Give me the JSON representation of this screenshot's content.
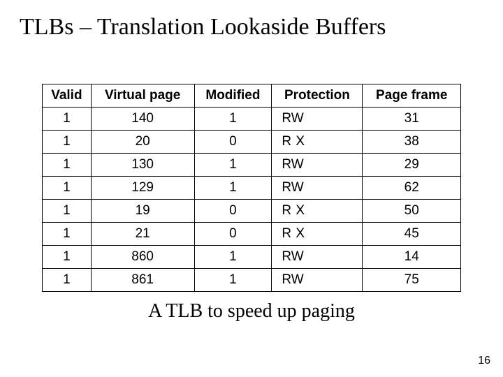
{
  "title": "TLBs – Translation Lookaside Buffers",
  "caption": "A TLB to speed up paging",
  "page_number": "16",
  "table": {
    "headers": [
      "Valid",
      "Virtual page",
      "Modified",
      "Protection",
      "Page frame"
    ],
    "rows": [
      {
        "valid": "1",
        "vpage": "140",
        "mod": "1",
        "prot": "RW",
        "frame": "31"
      },
      {
        "valid": "1",
        "vpage": "20",
        "mod": "0",
        "prot": "R  X",
        "frame": "38"
      },
      {
        "valid": "1",
        "vpage": "130",
        "mod": "1",
        "prot": "RW",
        "frame": "29"
      },
      {
        "valid": "1",
        "vpage": "129",
        "mod": "1",
        "prot": "RW",
        "frame": "62"
      },
      {
        "valid": "1",
        "vpage": "19",
        "mod": "0",
        "prot": "R  X",
        "frame": "50"
      },
      {
        "valid": "1",
        "vpage": "21",
        "mod": "0",
        "prot": "R  X",
        "frame": "45"
      },
      {
        "valid": "1",
        "vpage": "860",
        "mod": "1",
        "prot": "RW",
        "frame": "14"
      },
      {
        "valid": "1",
        "vpage": "861",
        "mod": "1",
        "prot": "RW",
        "frame": "75"
      }
    ]
  },
  "chart_data": {
    "type": "table",
    "title": "TLBs – Translation Lookaside Buffers",
    "headers": [
      "Valid",
      "Virtual page",
      "Modified",
      "Protection",
      "Page frame"
    ],
    "rows": [
      [
        1,
        140,
        1,
        "RW",
        31
      ],
      [
        1,
        20,
        0,
        "R X",
        38
      ],
      [
        1,
        130,
        1,
        "RW",
        29
      ],
      [
        1,
        129,
        1,
        "RW",
        62
      ],
      [
        1,
        19,
        0,
        "R X",
        50
      ],
      [
        1,
        21,
        0,
        "R X",
        45
      ],
      [
        1,
        860,
        1,
        "RW",
        14
      ],
      [
        1,
        861,
        1,
        "RW",
        75
      ]
    ]
  }
}
